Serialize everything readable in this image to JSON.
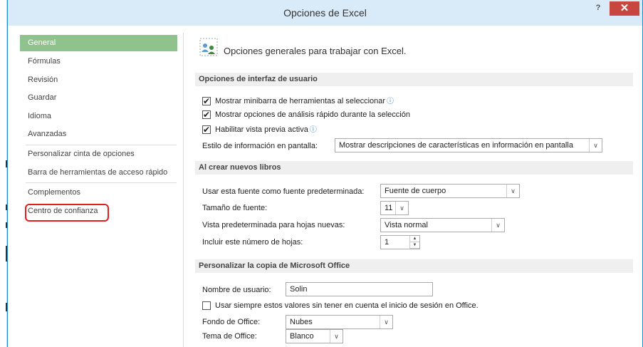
{
  "window": {
    "title": "Opciones de Excel",
    "help_label": "?",
    "close_label": "✕"
  },
  "sidebar": {
    "items": [
      {
        "label": "General",
        "active": true
      },
      {
        "label": "Fórmulas"
      },
      {
        "label": "Revisión"
      },
      {
        "label": "Guardar"
      },
      {
        "label": "Idioma"
      },
      {
        "label": "Avanzadas"
      },
      {
        "label": "Personalizar cinta de opciones"
      },
      {
        "label": "Barra de herramientas de acceso rápido"
      },
      {
        "label": "Complementos"
      },
      {
        "label": "Centro de confianza"
      }
    ]
  },
  "main": {
    "header": "Opciones generales para trabajar con Excel.",
    "ui_section": {
      "title": "Opciones de interfaz de usuario",
      "cb_minibar": "Mostrar minibarra de herramientas al seleccionar",
      "cb_quick": "Mostrar opciones de análisis rápido durante la selección",
      "cb_preview": "Habilitar vista previa activa",
      "tooltip_label": "Estilo de información en pantalla:",
      "tooltip_value": "Mostrar descripciones de características en información en pantalla"
    },
    "new_section": {
      "title": "Al crear nuevos libros",
      "font_label": "Usar esta fuente como fuente predeterminada:",
      "font_value": "Fuente de cuerpo",
      "size_label": "Tamaño de fuente:",
      "size_value": "11",
      "view_label": "Vista predeterminada para hojas nuevas:",
      "view_value": "Vista normal",
      "sheets_label": "Incluir este número de hojas:",
      "sheets_value": "1"
    },
    "office_section": {
      "title": "Personalizar la copia de Microsoft Office",
      "user_label": "Nombre de usuario:",
      "user_value": "Solin",
      "cb_always": "Usar siempre estos valores sin tener en cuenta el inicio de sesión en Office.",
      "bg_label": "Fondo de Office:",
      "bg_value": "Nubes",
      "theme_label": "Tema de Office:",
      "theme_value": "Blanco"
    }
  },
  "icons": {
    "arrow": "∨",
    "spin_up": "▲",
    "spin_down": "▼",
    "info": "ⓘ"
  }
}
